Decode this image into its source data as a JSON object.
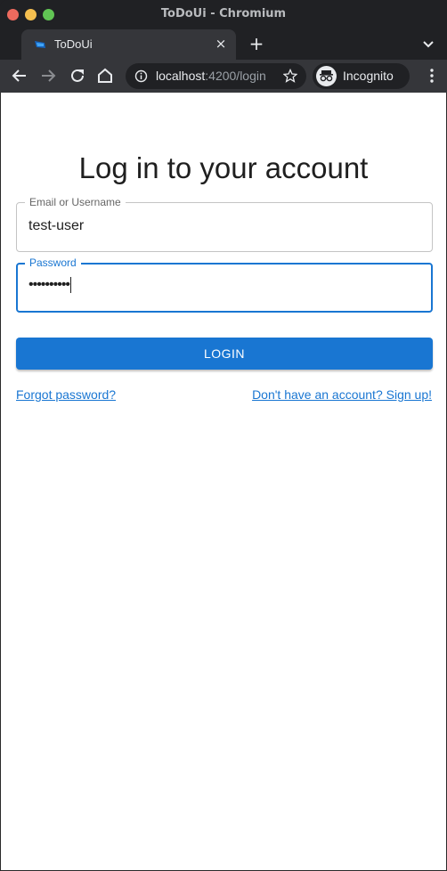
{
  "window": {
    "title": "ToDoUi - Chromium"
  },
  "tab": {
    "title": "ToDoUi",
    "close_glyph": "×",
    "new_tab_glyph": "+"
  },
  "toolbar": {
    "url_host": "localhost",
    "url_rest": ":4200/login",
    "incognito_label": "Incognito"
  },
  "page": {
    "heading": "Log in to your account",
    "username_label": "Email or Username",
    "username_value": "test-user",
    "password_label": "Password",
    "password_value": "••••••••••",
    "login_button": "LOGIN",
    "forgot_link": "Forgot password?",
    "signup_link": "Don't have an account? Sign up!"
  },
  "colors": {
    "primary": "#1976d2",
    "chrome_dark": "#202124",
    "chrome_toolbar": "#35363a"
  }
}
